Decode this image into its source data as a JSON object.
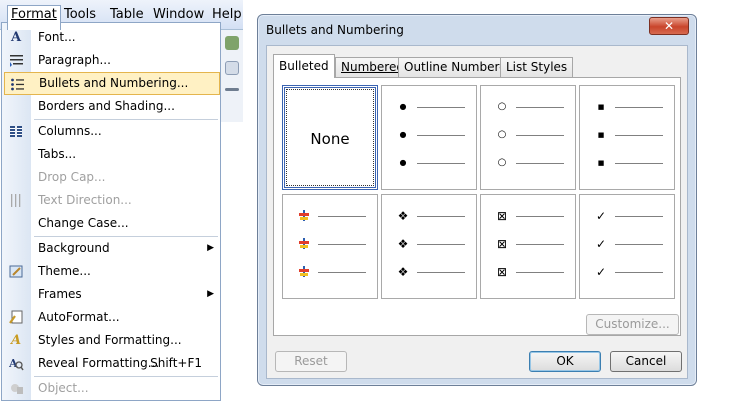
{
  "menubar": {
    "items": [
      {
        "label": "Format",
        "open": true
      },
      {
        "label": "Tools"
      },
      {
        "label": "Table"
      },
      {
        "label": "Window"
      },
      {
        "label": "Help"
      }
    ]
  },
  "format_menu": {
    "items": [
      {
        "label": "Font...",
        "icon": "font-icon",
        "enabled": true
      },
      {
        "label": "Paragraph...",
        "icon": "paragraph-icon",
        "enabled": true
      },
      {
        "label": "Bullets and Numbering...",
        "icon": "bullets-icon",
        "enabled": true,
        "highlighted": true
      },
      {
        "label": "Borders and Shading...",
        "icon": null,
        "enabled": true
      },
      {
        "label": "Columns...",
        "icon": "columns-icon",
        "enabled": true
      },
      {
        "label": "Tabs...",
        "icon": null,
        "enabled": true
      },
      {
        "label": "Drop Cap...",
        "icon": null,
        "enabled": false
      },
      {
        "label": "Text Direction...",
        "icon": "text-direction-icon",
        "enabled": false
      },
      {
        "label": "Change Case...",
        "icon": null,
        "enabled": true
      },
      {
        "label": "Background",
        "icon": null,
        "enabled": true,
        "submenu": true
      },
      {
        "label": "Theme...",
        "icon": "theme-icon",
        "enabled": true
      },
      {
        "label": "Frames",
        "icon": null,
        "enabled": true,
        "submenu": true
      },
      {
        "label": "AutoFormat...",
        "icon": "autoformat-icon",
        "enabled": true
      },
      {
        "label": "Styles and Formatting...",
        "icon": "styles-icon",
        "enabled": true
      },
      {
        "label": "Reveal Formatting...",
        "icon": "reveal-formatting-icon",
        "enabled": true,
        "shortcut": "Shift+F1"
      },
      {
        "label": "Object...",
        "icon": "object-icon",
        "enabled": false
      }
    ]
  },
  "dialog": {
    "title": "Bullets and Numbering",
    "close_symbol": "✕",
    "tabs": [
      {
        "label": "Bulleted",
        "active": true
      },
      {
        "label": "Numbered"
      },
      {
        "label": "Outline Numbered"
      },
      {
        "label": "List Styles"
      }
    ],
    "bullet_cells": [
      {
        "kind": "none",
        "label": "None",
        "selected": true
      },
      {
        "kind": "glyph",
        "symbol": "●",
        "icon": "filled-circle-bullet"
      },
      {
        "kind": "glyph",
        "symbol": "○",
        "icon": "hollow-circle-bullet"
      },
      {
        "kind": "glyph",
        "symbol": "■",
        "icon": "filled-square-bullet"
      },
      {
        "kind": "picture",
        "icon": "picture-bullet"
      },
      {
        "kind": "glyph",
        "symbol": "❖",
        "icon": "diamond-bullet"
      },
      {
        "kind": "glyph",
        "symbol": "⊠",
        "icon": "boxed-x-bullet"
      },
      {
        "kind": "glyph",
        "symbol": "✓",
        "icon": "checkmark-bullet"
      }
    ],
    "buttons": {
      "customize": "Customize...",
      "reset": "Reset",
      "ok": "OK",
      "cancel": "Cancel"
    }
  }
}
